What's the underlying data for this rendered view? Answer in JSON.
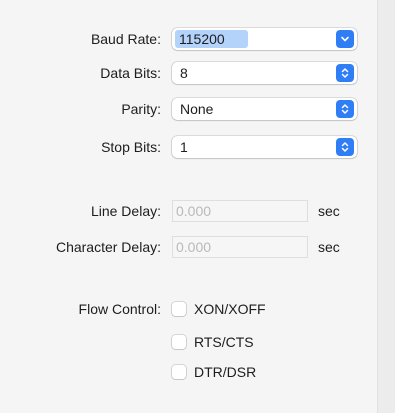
{
  "serial": {
    "baud_rate": {
      "label": "Baud Rate:",
      "value": "115200"
    },
    "data_bits": {
      "label": "Data Bits:",
      "value": "8"
    },
    "parity": {
      "label": "Parity:",
      "value": "None"
    },
    "stop_bits": {
      "label": "Stop Bits:",
      "value": "1"
    }
  },
  "delays": {
    "line_delay": {
      "label": "Line Delay:",
      "placeholder": "0.000",
      "unit": "sec"
    },
    "character_delay": {
      "label": "Character Delay:",
      "placeholder": "0.000",
      "unit": "sec"
    }
  },
  "flow_control": {
    "label": "Flow Control:",
    "options": [
      {
        "label": "XON/XOFF",
        "checked": false
      },
      {
        "label": "RTS/CTS",
        "checked": false
      },
      {
        "label": "DTR/DSR",
        "checked": false
      }
    ]
  },
  "colors": {
    "accent": "#2f7ef6",
    "selection": "#b3d3fa",
    "placeholder_text": "#b9b9b9"
  },
  "icons": {
    "baud_popup": "chevron-down-icon",
    "other_popups": "up-down-chevron-icon"
  }
}
